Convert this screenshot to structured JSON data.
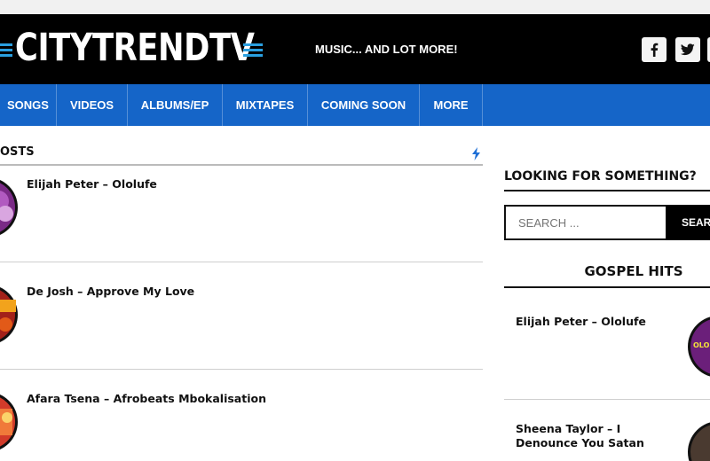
{
  "header": {
    "logo_text": "CITYTRENDTV",
    "tagline": "MUSIC... AND LOT MORE!",
    "social": [
      {
        "name": "facebook",
        "glyph": "f"
      },
      {
        "name": "twitter",
        "glyph": "twitter-bird"
      }
    ]
  },
  "nav": {
    "items": [
      "SONGS",
      "VIDEOS",
      "ALBUMS/EP",
      "MIXTAPES",
      "COMING SOON",
      "MORE"
    ]
  },
  "main": {
    "section_title": "OSTS",
    "posts": [
      {
        "title": "Elijah Peter – Ololufe"
      },
      {
        "title": "De Josh – Approve My Love"
      },
      {
        "title": "Afara Tsena – Afrobeats Mbokalisation"
      }
    ]
  },
  "sidebar": {
    "search_title": "LOOKING FOR SOMETHING?",
    "search_placeholder": "SEARCH ...",
    "search_button": "SEARCH",
    "gospel_title": "GOSPEL HITS",
    "gospel_items": [
      {
        "title": "Elijah Peter – Ololufe",
        "thumb_text": "OLOLU"
      },
      {
        "title": "Sheena Taylor – I Denounce You Satan"
      }
    ]
  },
  "colors": {
    "nav_bg": "#1565c8",
    "header_bg": "#000000",
    "logo_accent": "#2a9fe0",
    "bolt": "#1f6fd6"
  }
}
